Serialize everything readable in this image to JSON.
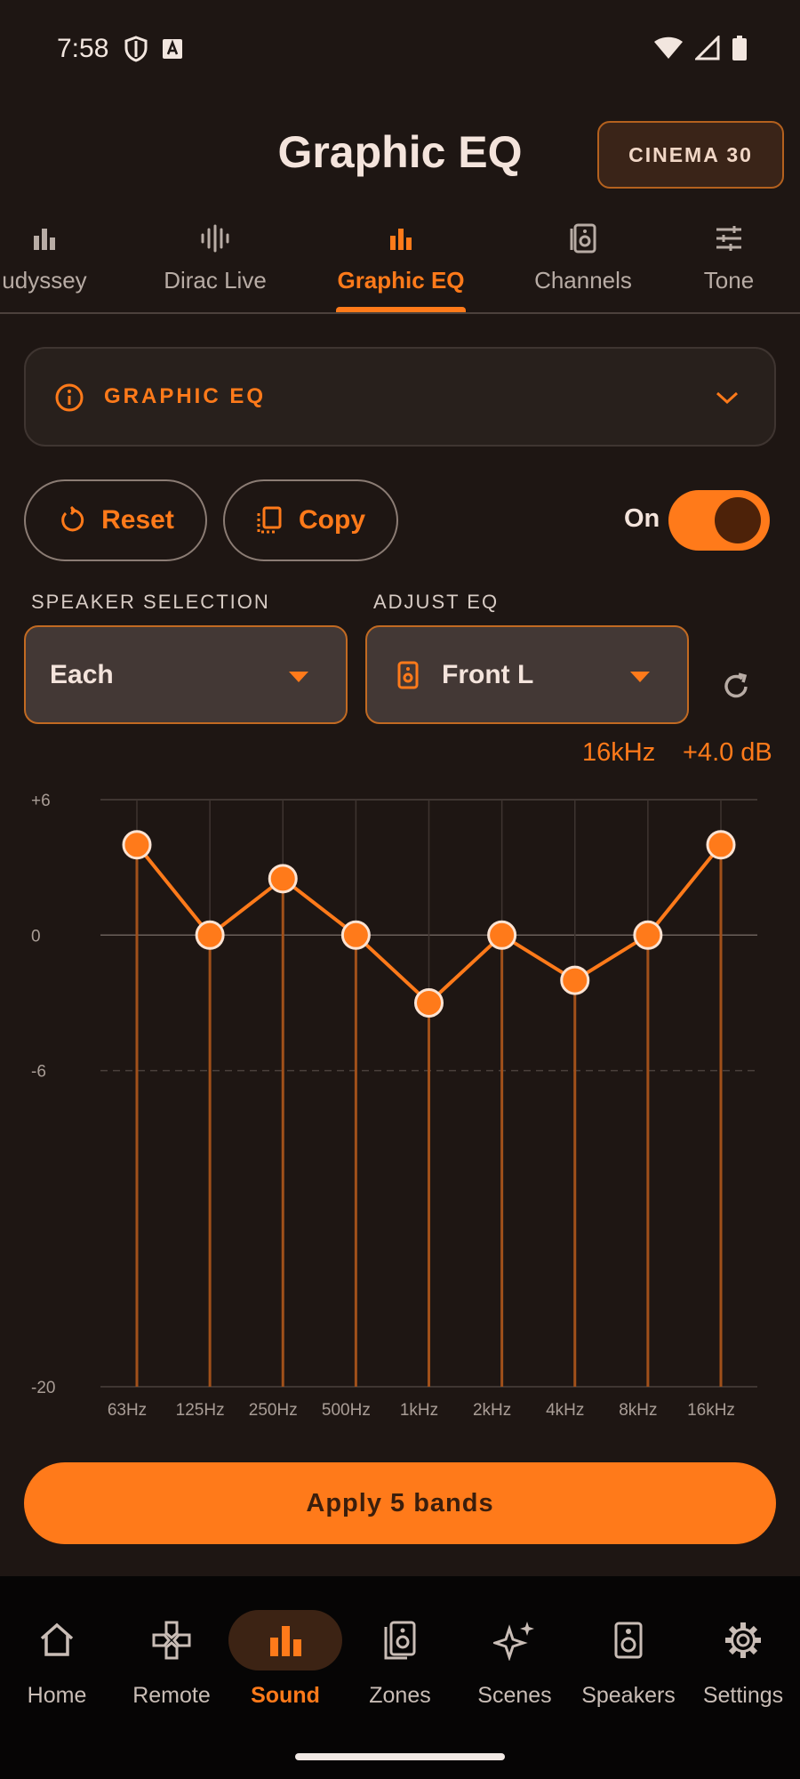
{
  "status_bar": {
    "time": "7:58"
  },
  "header": {
    "title": "Graphic EQ",
    "preset_label": "CINEMA 30"
  },
  "tabs": [
    {
      "label": "udyssey",
      "icon": "bar-chart-icon"
    },
    {
      "label": "Dirac Live",
      "icon": "waveform-icon"
    },
    {
      "label": "Graphic EQ",
      "icon": "bar-chart-icon",
      "active": true
    },
    {
      "label": "Channels",
      "icon": "speaker-icon"
    },
    {
      "label": "Tone",
      "icon": "sliders-icon"
    }
  ],
  "section": {
    "title": "GRAPHIC EQ",
    "icon": "info-icon"
  },
  "actions": {
    "reset_label": "Reset",
    "copy_label": "Copy",
    "toggle_label": "On",
    "toggle_on": true
  },
  "speaker_selection": {
    "label": "SPEAKER SELECTION",
    "value": "Each"
  },
  "adjust_eq": {
    "label": "ADJUST EQ",
    "value": "Front L"
  },
  "readout": {
    "freq": "16kHz",
    "db": "+4.0 dB"
  },
  "chart_data": {
    "type": "line",
    "categories": [
      "63Hz",
      "125Hz",
      "250Hz",
      "500Hz",
      "1kHz",
      "2kHz",
      "4kHz",
      "8kHz",
      "16kHz"
    ],
    "values": [
      4.0,
      0.0,
      2.5,
      0.0,
      -3.0,
      0.0,
      -2.0,
      0.0,
      4.0
    ],
    "y_ticks": [
      "+6",
      "0",
      "-6",
      "-20"
    ],
    "ylim": [
      -20,
      6
    ],
    "grid": true,
    "accent_color": "#ff7a1a"
  },
  "apply_button": {
    "label": "Apply 5 bands"
  },
  "bottom_nav": [
    {
      "label": "Home",
      "icon": "home-icon"
    },
    {
      "label": "Remote",
      "icon": "gamepad-icon"
    },
    {
      "label": "Sound",
      "icon": "bar-chart-icon",
      "active": true
    },
    {
      "label": "Zones",
      "icon": "speaker-group-icon"
    },
    {
      "label": "Scenes",
      "icon": "sparkles-icon"
    },
    {
      "label": "Speakers",
      "icon": "speaker-icon"
    },
    {
      "label": "Settings",
      "icon": "gear-icon"
    }
  ]
}
